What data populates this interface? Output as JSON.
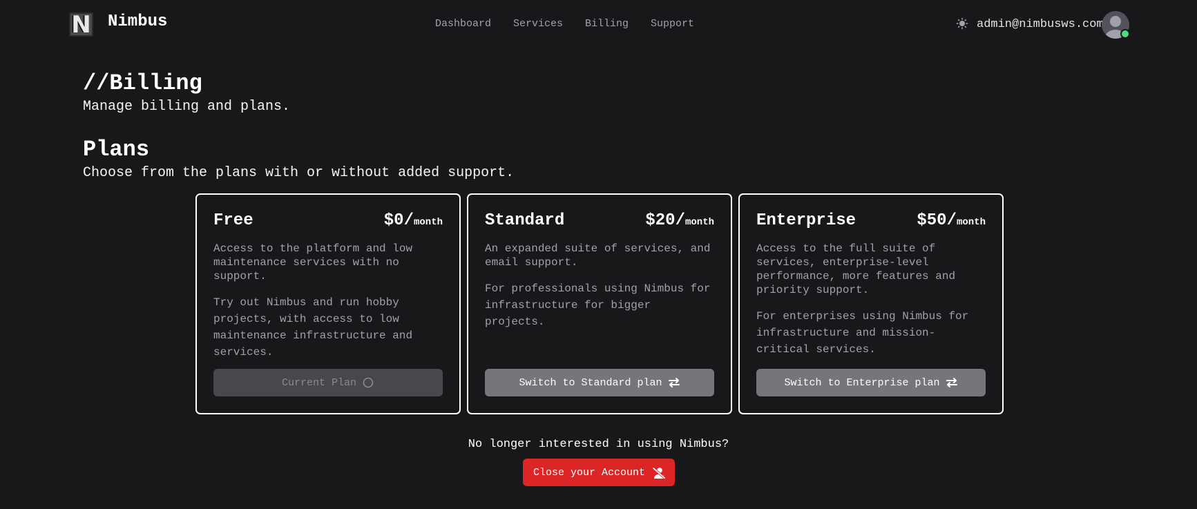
{
  "app": {
    "brand": "Nimbus",
    "logo_letter": "N"
  },
  "nav": {
    "links": [
      {
        "label": "Dashboard",
        "icon": null
      },
      {
        "label": "Services",
        "icon": null
      },
      {
        "label": "Billing",
        "icon": null
      },
      {
        "label": "Support",
        "icon": null
      }
    ],
    "theme_icon": "sun-icon",
    "user_email": "admin@nimbusws.com",
    "user_status": "online"
  },
  "page": {
    "title": "//Billing",
    "subtitle": "Manage billing and plans."
  },
  "plans_section": {
    "title": "Plans",
    "subtitle": "Choose from the plans with or without added support.",
    "plans": [
      {
        "name": "Free",
        "price": "$0/",
        "period": "month",
        "description": "Access to the platform and low maintenance services with no support.",
        "detail": "Try out Nimbus and run hobby projects, with access to low maintenance infrastructure and services.",
        "button_label": "Current Plan",
        "button_icon": "circle-icon",
        "is_current": true
      },
      {
        "name": "Standard",
        "price": "$20/",
        "period": "month",
        "description": "An expanded suite of services, and email support.",
        "detail": "For professionals using Nimbus for infrastructure for bigger projects.",
        "button_label": "Switch to Standard plan",
        "button_icon": "swap-arrows-icon",
        "is_current": false
      },
      {
        "name": "Enterprise",
        "price": "$50/",
        "period": "month",
        "description": "Access to the full suite of services, enterprise-level performance, more features and priority support.",
        "detail": "For enterprises using Nimbus for infrastructure and mission-critical services.",
        "button_label": "Switch to Enterprise plan",
        "button_icon": "swap-arrows-icon",
        "is_current": false
      }
    ]
  },
  "close_account": {
    "question": "No longer interested in using Nimbus?",
    "button_label": "Close your Account",
    "button_icon": "user-slash-icon"
  },
  "colors": {
    "background": "#18181b",
    "danger": "#dc2626",
    "online": "#4ade80",
    "muted_text": "#a1a1aa",
    "switch_button": "#75757c",
    "current_button": "#47474c"
  }
}
